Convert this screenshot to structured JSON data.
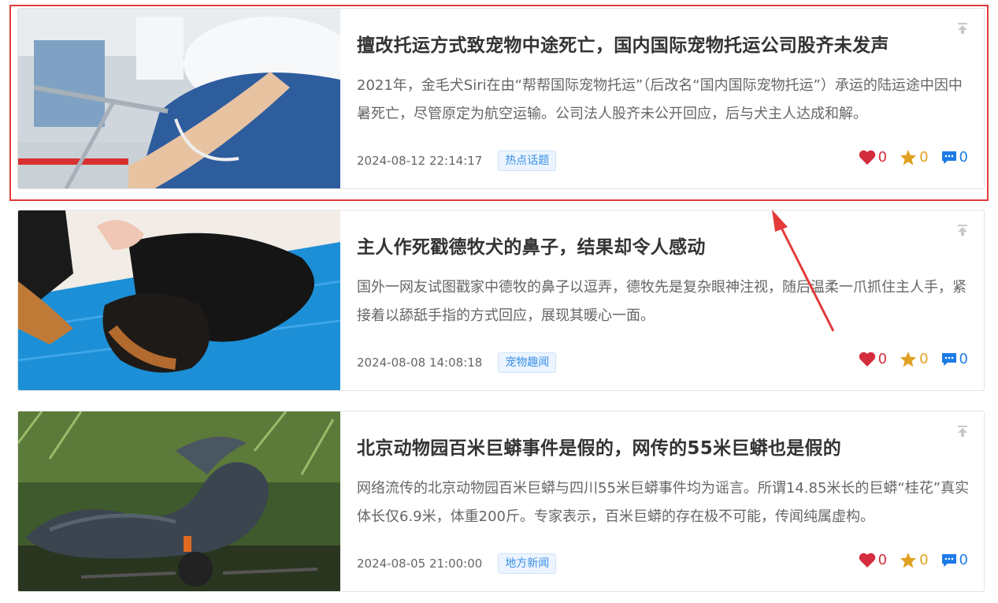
{
  "articles": [
    {
      "title": "擅改托运方式致宠物中途死亡，国内国际宠物托运公司股齐未发声",
      "summary": "2021年，金毛犬Siri在由“帮帮国际宠物托运”（后改名“国内国际宠物托运”）承运的陆运途中因中暑死亡，尽管原定为航空运输。公司法人股齐未公开回应，后与犬主人达成和解。",
      "date": "2024-08-12 22:14:17",
      "tag": "热点话题",
      "likes": "0",
      "stars": "0",
      "comments": "0"
    },
    {
      "title": "主人作死戳德牧犬的鼻子，结果却令人感动",
      "summary": "国外一网友试图戳家中德牧的鼻子以逗弄，德牧先是复杂眼神注视，随后温柔一爪抓住主人手，紧接着以舔舐手指的方式回应，展现其暖心一面。",
      "date": "2024-08-08 14:08:18",
      "tag": "宠物趣闻",
      "likes": "0",
      "stars": "0",
      "comments": "0"
    },
    {
      "title": "北京动物园百米巨蟒事件是假的，网传的55米巨蟒也是假的",
      "summary": "网络流传的北京动物园百米巨蟒与四川55米巨蟒事件均为谣言。所谓14.85米长的巨蟒“桂花”真实体长仅6.9米，体重200斤。专家表示，百米巨蟒的存在极不可能，传闻纯属虚构。",
      "date": "2024-08-05 21:00:00",
      "tag": "地方新闻",
      "likes": "0",
      "stars": "0",
      "comments": "0"
    }
  ],
  "colors": {
    "like": "#d42d3d",
    "star": "#e0a021",
    "comment": "#1d7be6",
    "tag_text": "#3a8ee6",
    "highlight": "#e33a3a"
  },
  "icons": [
    "pin-top-icon",
    "heart-icon",
    "star-icon",
    "comment-icon"
  ]
}
